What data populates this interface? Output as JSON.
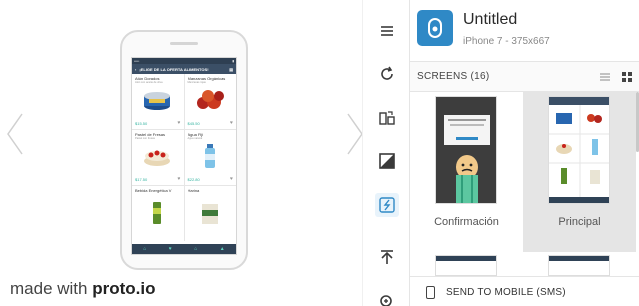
{
  "preview": {
    "made_with": "made with",
    "brand": "proto.io",
    "device_screen": {
      "header_title": "¡ELIGE DE LA OFERTA ALIMENTOS!",
      "products": [
        {
          "name": "Atún Dorados",
          "sub": "Atún con aceite de oliva",
          "price": "$15.50"
        },
        {
          "name": "Manzanas Orgánicas",
          "sub": "Manzanas rojas",
          "price": "$45.50"
        },
        {
          "name": "Pastel de Fresas",
          "sub": "Pastel con fresas",
          "price": "$17.50"
        },
        {
          "name": "Agua Fiji",
          "sub": "Agua natural",
          "price": "$22.80"
        },
        {
          "name": "Bebida Energética V",
          "sub": "",
          "price": ""
        },
        {
          "name": "Harina",
          "sub": "",
          "price": ""
        }
      ]
    }
  },
  "toolbar": {
    "tools": [
      "menu-icon",
      "refresh-icon",
      "rotate-device-icon",
      "contrast-icon",
      "hotspot-icon",
      "upload-icon",
      "zoom-icon"
    ]
  },
  "project": {
    "title": "Untitled",
    "device": "iPhone 7 - 375x667",
    "accent": "#2f89c6"
  },
  "screens": {
    "header": "SCREENS (16)",
    "items": [
      {
        "label": "Confirmación",
        "selected": false
      },
      {
        "label": "Principal",
        "selected": true
      }
    ]
  },
  "send": {
    "label": "SEND TO MOBILE (SMS)"
  }
}
